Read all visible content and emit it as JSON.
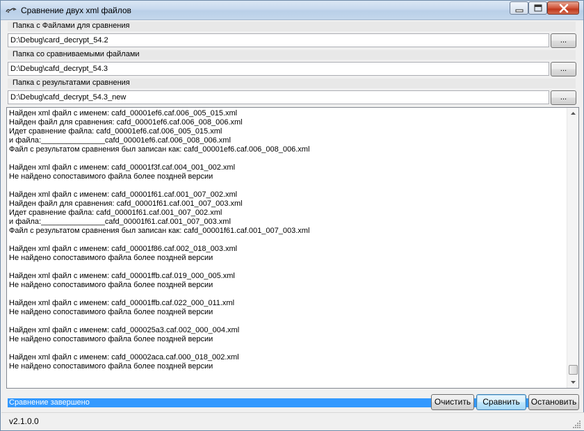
{
  "window": {
    "title": "Сравнение двух xml файлов",
    "icons": {
      "app": "xml-compare-app-icon",
      "minimize": "minimize-icon",
      "maximize": "maximize-icon",
      "close": "close-icon"
    },
    "colors": {
      "titlebar": "#c7d9ee",
      "close_button": "#c8432a",
      "selection": "#3399ff"
    }
  },
  "folders": [
    {
      "label": "Папка с Файлами для сравнения",
      "value": "D:\\Debug\\card_decrypt_54.2",
      "browse_label": "..."
    },
    {
      "label": "Папка со сравниваемыми файлами",
      "value": "D:\\Debug\\cafd_decrypt_54.3",
      "browse_label": "..."
    },
    {
      "label": "Папка с результатами сравнения",
      "value": "D:\\Debug\\cafd_decrypt_54.3_new",
      "browse_label": "..."
    }
  ],
  "log": {
    "lines": [
      "Найден xml файл с именем: cafd_00001ef6.caf.006_005_015.xml",
      "Найден файл для сравнения: cafd_00001ef6.caf.006_008_006.xml",
      "Идет сравнение файла: cafd_00001ef6.caf.006_005_015.xml",
      "и файла:_______________cafd_00001ef6.caf.006_008_006.xml",
      "Файл с результатом сравнения был записан как: cafd_00001ef6.caf.006_008_006.xml",
      "",
      "Найден xml файл с именем: cafd_00001f3f.caf.004_001_002.xml",
      "Не найдено сопоставимого файла более поздней версии",
      "",
      "Найден xml файл с именем: cafd_00001f61.caf.001_007_002.xml",
      "Найден файл для сравнения: cafd_00001f61.caf.001_007_003.xml",
      "Идет сравнение файла: cafd_00001f61.caf.001_007_002.xml",
      "и файла:_______________cafd_00001f61.caf.001_007_003.xml",
      "Файл с результатом сравнения был записан как: cafd_00001f61.caf.001_007_003.xml",
      "",
      "Найден xml файл с именем: cafd_00001f86.caf.002_018_003.xml",
      "Не найдено сопоставимого файла более поздней версии",
      "",
      "Найден xml файл с именем: cafd_00001ffb.caf.019_000_005.xml",
      "Не найдено сопоставимого файла более поздней версии",
      "",
      "Найден xml файл с именем: cafd_00001ffb.caf.022_000_011.xml",
      "Не найдено сопоставимого файла более поздней версии",
      "",
      "Найден xml файл с именем: cafd_000025a3.caf.002_000_004.xml",
      "Не найдено сопоставимого файла более поздней версии",
      "",
      "Найден xml файл с именем: cafd_00002aca.caf.000_018_002.xml",
      "Не найдено сопоставимого файла более поздней версии",
      "",
      "",
      ""
    ],
    "status_line": "Сравнение завершено",
    "scroll_up_icon": "scroll-up-arrow-icon",
    "scroll_down_icon": "scroll-down-arrow-icon"
  },
  "actions": {
    "clear": "Очистить",
    "compare": "Сравнить",
    "stop": "Остановить"
  },
  "status": {
    "version": "v2.1.0.0",
    "grip_icon": "resize-grip-icon"
  }
}
